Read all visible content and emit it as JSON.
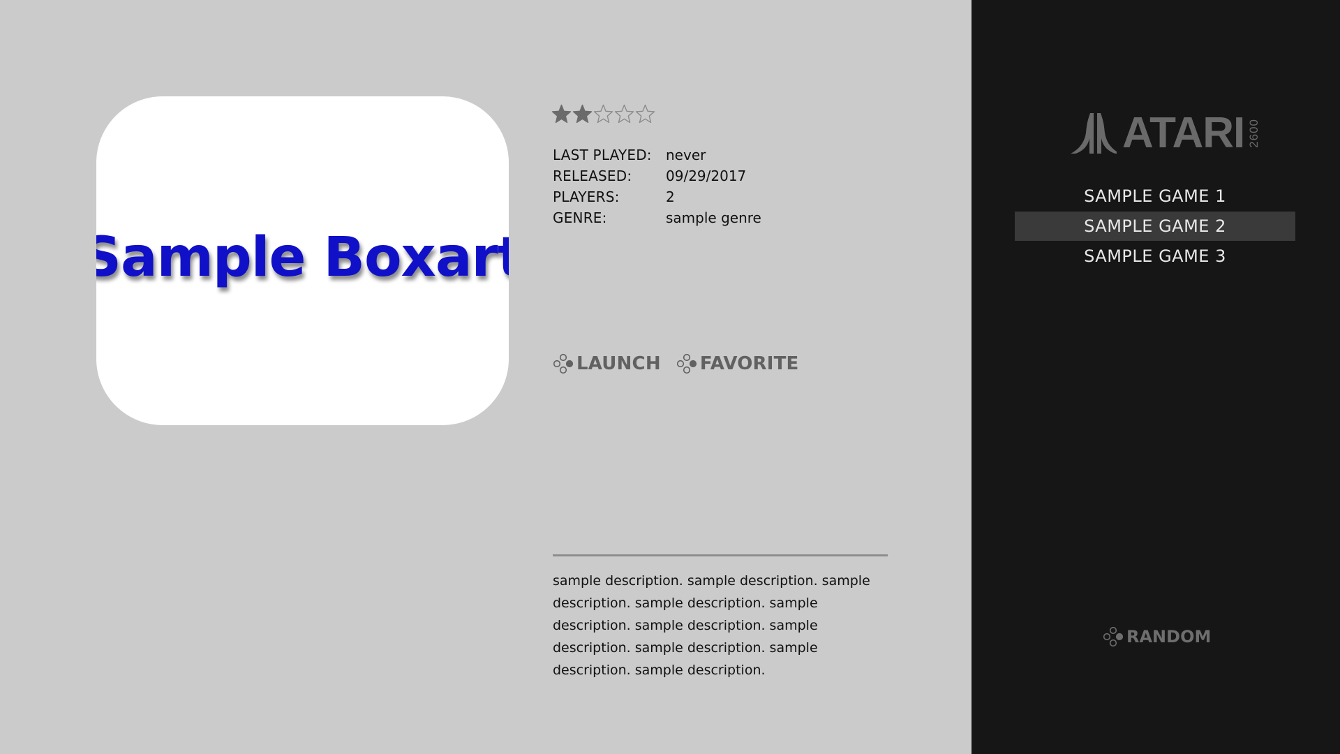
{
  "boxart": {
    "text": "Sample Boxart",
    "color": "#1010c8"
  },
  "rating": {
    "value": 2,
    "max": 5,
    "filled_color": "#6b6b6b",
    "empty_color": "#8a8a8a"
  },
  "metadata": {
    "rows": [
      {
        "label": "LAST PLAYED:",
        "value": "never"
      },
      {
        "label": "RELEASED:",
        "value": "09/29/2017"
      },
      {
        "label": "PLAYERS:",
        "value": "2"
      },
      {
        "label": "GENRE:",
        "value": "sample genre"
      }
    ]
  },
  "actions": {
    "launch_label": "LAUNCH",
    "launch_icon": "button-icon",
    "favorite_label": "FAVORITE",
    "favorite_icon": "button-icon"
  },
  "description": "sample description. sample description. sample description. sample description. sample description. sample description. sample description. sample description. sample description. sample description.",
  "sidebar": {
    "logo_word": "ATARI",
    "logo_model": "2600",
    "games": [
      {
        "label": "SAMPLE GAME 1",
        "selected": false
      },
      {
        "label": "SAMPLE GAME 2",
        "selected": true
      },
      {
        "label": "SAMPLE GAME 3",
        "selected": false
      }
    ],
    "random_label": "RANDOM",
    "random_icon": "button-icon",
    "selected_bg": "#3a3a3a"
  },
  "colors": {
    "main_bg": "#cbcbcb",
    "sidebar_bg": "#161616",
    "text_dark": "#111111",
    "text_light": "#e8e8e8",
    "action_gray": "#616161"
  }
}
